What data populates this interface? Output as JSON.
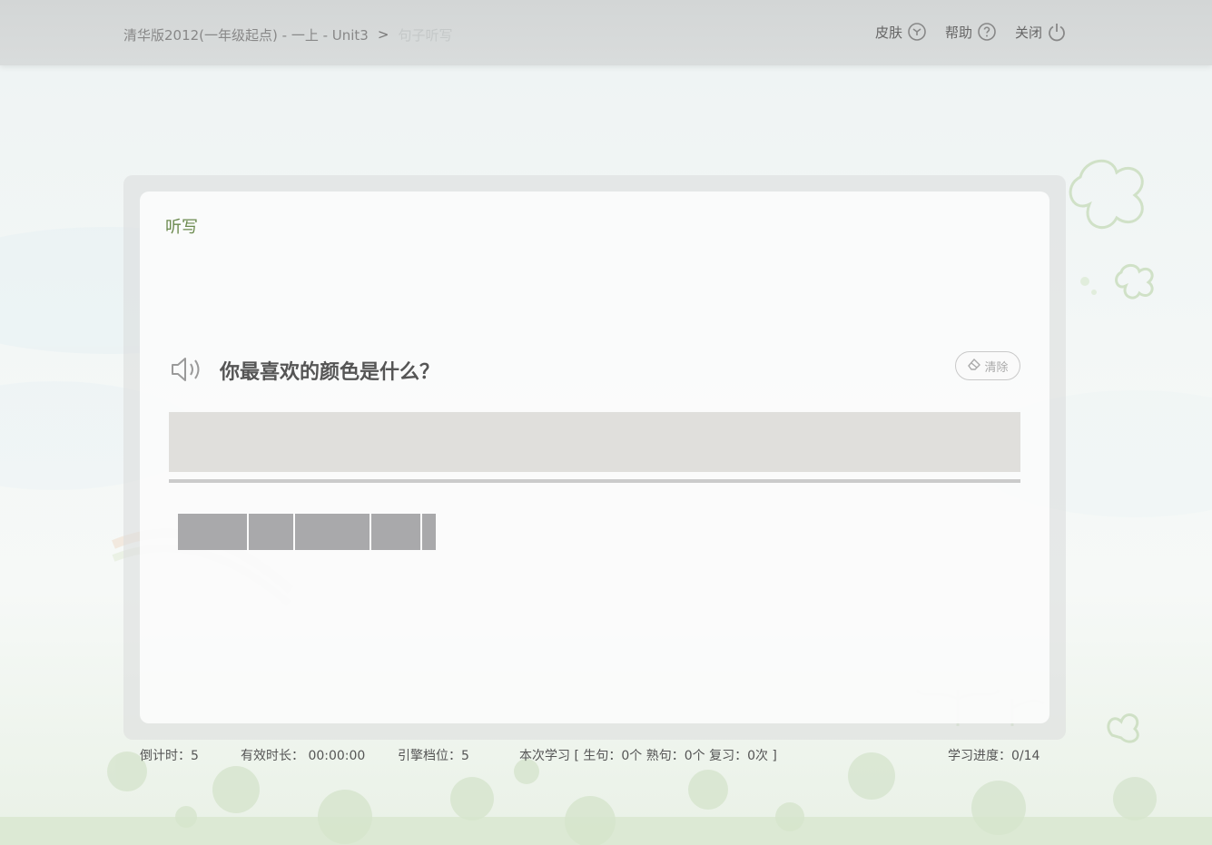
{
  "header": {
    "breadcrumb_path": "清华版2012(一年级起点) - 一上 - Unit3",
    "breadcrumb_sep": ">",
    "breadcrumb_current": "句子听写",
    "actions": [
      {
        "label": "皮肤",
        "icon": "skin-icon"
      },
      {
        "label": "帮助",
        "icon": "help-icon"
      },
      {
        "label": "关闭",
        "icon": "power-icon"
      }
    ]
  },
  "panel": {
    "title": "听写",
    "sentence": "你最喜欢的颜色是什么？",
    "clear_label": "清除",
    "answer_value": ""
  },
  "status": {
    "countdown_label": "倒计时：",
    "countdown_value": "5",
    "duration_label": "有效时长：",
    "duration_value": "00:00:00",
    "engine_label": "引擎档位：",
    "engine_value": "5",
    "session_text": "本次学习 [ 生句：0个 熟句：0个 复习：0次 ]",
    "progress_label": "学习进度：",
    "progress_value": "0/14"
  },
  "colors": {
    "title_green": "#6b8a4e",
    "answer_bg": "#e0dfdc",
    "block_gray": "#a9a9ab"
  }
}
